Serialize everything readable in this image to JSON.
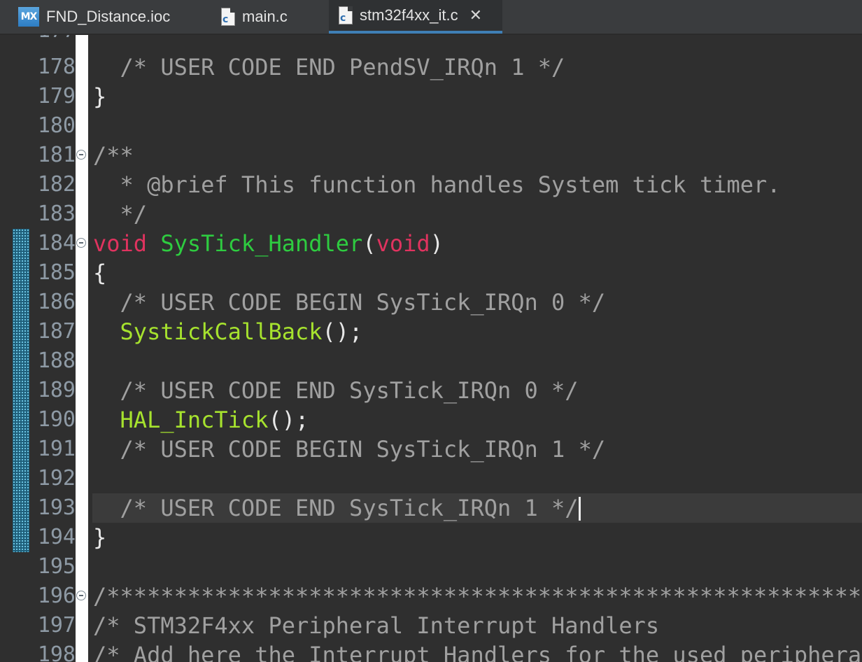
{
  "tabs": [
    {
      "label": "FND_Distance.ioc",
      "icon": "mx-file-icon",
      "icon_text": "MX",
      "active": false
    },
    {
      "label": "main.c",
      "icon": "c-file-icon",
      "icon_text": "c",
      "active": false
    },
    {
      "label": "stm32f4xx_it.c",
      "icon": "c-file-icon",
      "icon_text": "c",
      "active": true,
      "close_glyph": "✕"
    }
  ],
  "editor": {
    "top_partial_number": "177",
    "current_line_number": "193",
    "changed_lines": [
      "184",
      "194"
    ],
    "lines": [
      {
        "number": "178",
        "fold": false,
        "tokens": [
          {
            "text": "  /* USER CODE END PendSV_IRQn 1 */",
            "type": "comment"
          }
        ]
      },
      {
        "number": "179",
        "fold": false,
        "tokens": [
          {
            "text": "}",
            "type": "punct"
          }
        ]
      },
      {
        "number": "180",
        "fold": false,
        "tokens": []
      },
      {
        "number": "181",
        "fold": true,
        "tokens": [
          {
            "text": "/**",
            "type": "comment"
          }
        ]
      },
      {
        "number": "182",
        "fold": false,
        "tokens": [
          {
            "text": "  * @brief This function handles System tick timer.",
            "type": "comment"
          }
        ]
      },
      {
        "number": "183",
        "fold": false,
        "tokens": [
          {
            "text": "  */",
            "type": "comment"
          }
        ]
      },
      {
        "number": "184",
        "fold": true,
        "tokens": [
          {
            "text": "void",
            "type": "keyword"
          },
          {
            "text": " ",
            "type": "plain"
          },
          {
            "text": "SysTick_Handler",
            "type": "func-decl"
          },
          {
            "text": "(",
            "type": "punct"
          },
          {
            "text": "void",
            "type": "keyword"
          },
          {
            "text": ")",
            "type": "punct"
          }
        ]
      },
      {
        "number": "185",
        "fold": false,
        "tokens": [
          {
            "text": "{",
            "type": "punct"
          }
        ]
      },
      {
        "number": "186",
        "fold": false,
        "tokens": [
          {
            "text": "  /* USER CODE BEGIN SysTick_IRQn 0 */",
            "type": "comment"
          }
        ]
      },
      {
        "number": "187",
        "fold": false,
        "tokens": [
          {
            "text": "  ",
            "type": "plain"
          },
          {
            "text": "SystickCallBack",
            "type": "func-call"
          },
          {
            "text": "();",
            "type": "punct"
          }
        ]
      },
      {
        "number": "188",
        "fold": false,
        "tokens": []
      },
      {
        "number": "189",
        "fold": false,
        "tokens": [
          {
            "text": "  /* USER CODE END SysTick_IRQn 0 */",
            "type": "comment"
          }
        ]
      },
      {
        "number": "190",
        "fold": false,
        "tokens": [
          {
            "text": "  ",
            "type": "plain"
          },
          {
            "text": "HAL_IncTick",
            "type": "func-call"
          },
          {
            "text": "();",
            "type": "punct"
          }
        ]
      },
      {
        "number": "191",
        "fold": false,
        "tokens": [
          {
            "text": "  /* USER CODE BEGIN SysTick_IRQn 1 */",
            "type": "comment"
          }
        ]
      },
      {
        "number": "192",
        "fold": false,
        "tokens": []
      },
      {
        "number": "193",
        "fold": false,
        "caret": true,
        "tokens": [
          {
            "text": "  /* USER CODE END SysTick_IRQn 1 */",
            "type": "comment"
          }
        ]
      },
      {
        "number": "194",
        "fold": false,
        "tokens": [
          {
            "text": "}",
            "type": "punct"
          }
        ]
      },
      {
        "number": "195",
        "fold": false,
        "tokens": []
      },
      {
        "number": "196",
        "fold": true,
        "tokens": [
          {
            "text": "/******************************************************************************/",
            "type": "comment"
          }
        ]
      },
      {
        "number": "197",
        "fold": false,
        "tokens": [
          {
            "text": "/* STM32F4xx Peripheral Interrupt Handlers                                    */",
            "type": "comment"
          }
        ]
      },
      {
        "number": "198",
        "fold": false,
        "tokens": [
          {
            "text": "/* Add here the Interrupt Handlers for the used peripherals.                  */",
            "type": "comment"
          }
        ]
      }
    ]
  }
}
